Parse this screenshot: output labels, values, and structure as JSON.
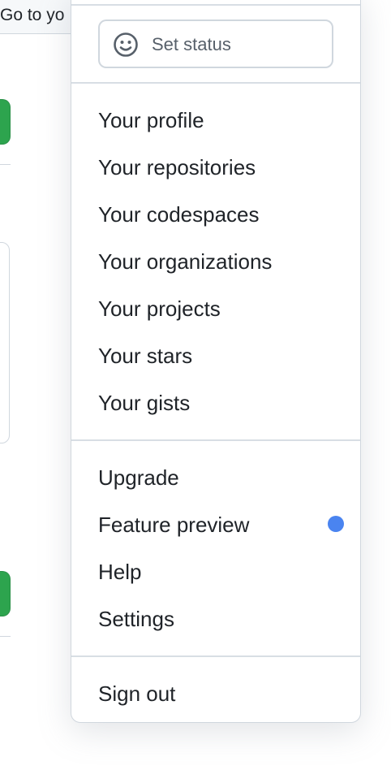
{
  "background": {
    "goto_text": "Go to yo"
  },
  "menu": {
    "set_status": {
      "label": "Set status",
      "icon": "smiley-icon"
    },
    "profile_items": [
      "Your profile",
      "Your repositories",
      "Your codespaces",
      "Your organizations",
      "Your projects",
      "Your stars",
      "Your gists"
    ],
    "account_items": [
      "Upgrade",
      "Feature preview",
      "Help",
      "Settings"
    ],
    "sign_out": "Sign out",
    "feature_preview_indicator_color": "#4a84f0"
  },
  "colors": {
    "border": "#d0d7de",
    "text": "#1f2328",
    "muted": "#57606a",
    "green": "#2da44e"
  }
}
